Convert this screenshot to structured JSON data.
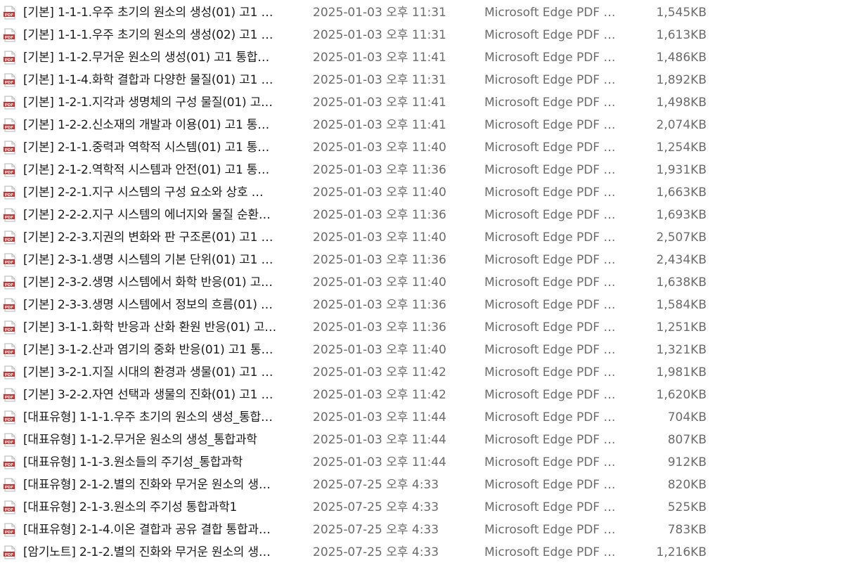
{
  "icon": {
    "name": "pdf-file-icon",
    "label": "PDF",
    "color": "#d0312d"
  },
  "files": [
    {
      "name": "[기본] 1-1-1.우주 초기의 원소의 생성(01) 고1 …",
      "modified": "2025-01-03 오후 11:31",
      "type": "Microsoft Edge PDF …",
      "size": "1,545KB"
    },
    {
      "name": "[기본] 1-1-1.우주 초기의 원소의 생성(02) 고1 …",
      "modified": "2025-01-03 오후 11:31",
      "type": "Microsoft Edge PDF …",
      "size": "1,613KB"
    },
    {
      "name": "[기본] 1-1-2.무거운 원소의 생성(01) 고1 통합…",
      "modified": "2025-01-03 오후 11:41",
      "type": "Microsoft Edge PDF …",
      "size": "1,486KB"
    },
    {
      "name": "[기본] 1-1-4.화학 결합과 다양한 물질(01) 고1 …",
      "modified": "2025-01-03 오후 11:31",
      "type": "Microsoft Edge PDF …",
      "size": "1,892KB"
    },
    {
      "name": "[기본] 1-2-1.지각과 생명체의 구성 물질(01) 고…",
      "modified": "2025-01-03 오후 11:41",
      "type": "Microsoft Edge PDF …",
      "size": "1,498KB"
    },
    {
      "name": "[기본] 1-2-2.신소재의 개발과 이용(01) 고1 통…",
      "modified": "2025-01-03 오후 11:41",
      "type": "Microsoft Edge PDF …",
      "size": "2,074KB"
    },
    {
      "name": "[기본] 2-1-1.중력과 역학적 시스템(01) 고1 통…",
      "modified": "2025-01-03 오후 11:40",
      "type": "Microsoft Edge PDF …",
      "size": "1,254KB"
    },
    {
      "name": "[기본] 2-1-2.역학적 시스템과 안전(01) 고1 통…",
      "modified": "2025-01-03 오후 11:36",
      "type": "Microsoft Edge PDF …",
      "size": "1,931KB"
    },
    {
      "name": "[기본] 2-2-1.지구 시스템의 구성 요소와 상호 …",
      "modified": "2025-01-03 오후 11:40",
      "type": "Microsoft Edge PDF …",
      "size": "1,663KB"
    },
    {
      "name": "[기본] 2-2-2.지구 시스템의 에너지와 물질 순환…",
      "modified": "2025-01-03 오후 11:36",
      "type": "Microsoft Edge PDF …",
      "size": "1,693KB"
    },
    {
      "name": "[기본] 2-2-3.지권의 변화와 판 구조론(01) 고1 …",
      "modified": "2025-01-03 오후 11:40",
      "type": "Microsoft Edge PDF …",
      "size": "2,507KB"
    },
    {
      "name": "[기본] 2-3-1.생명 시스템의 기본 단위(01) 고1 …",
      "modified": "2025-01-03 오후 11:36",
      "type": "Microsoft Edge PDF …",
      "size": "2,434KB"
    },
    {
      "name": "[기본] 2-3-2.생명 시스템에서 화학 반응(01) 고…",
      "modified": "2025-01-03 오후 11:40",
      "type": "Microsoft Edge PDF …",
      "size": "1,638KB"
    },
    {
      "name": "[기본] 2-3-3.생명 시스템에서 정보의 흐름(01) …",
      "modified": "2025-01-03 오후 11:36",
      "type": "Microsoft Edge PDF …",
      "size": "1,584KB"
    },
    {
      "name": "[기본] 3-1-1.화학 반응과 산화 환원 반응(01) 고…",
      "modified": "2025-01-03 오후 11:36",
      "type": "Microsoft Edge PDF …",
      "size": "1,251KB"
    },
    {
      "name": "[기본] 3-1-2.산과 염기의 중화 반응(01) 고1 통…",
      "modified": "2025-01-03 오후 11:40",
      "type": "Microsoft Edge PDF …",
      "size": "1,321KB"
    },
    {
      "name": "[기본] 3-2-1.지질 시대의 환경과 생물(01) 고1 …",
      "modified": "2025-01-03 오후 11:42",
      "type": "Microsoft Edge PDF …",
      "size": "1,981KB"
    },
    {
      "name": "[기본] 3-2-2.자연 선택과 생물의 진화(01) 고1 …",
      "modified": "2025-01-03 오후 11:42",
      "type": "Microsoft Edge PDF …",
      "size": "1,620KB"
    },
    {
      "name": "[대표유형] 1-1-1.우주 초기의 원소의 생성_통합…",
      "modified": "2025-01-03 오후 11:44",
      "type": "Microsoft Edge PDF …",
      "size": "704KB"
    },
    {
      "name": "[대표유형] 1-1-2.무거운 원소의 생성_통합과학",
      "modified": "2025-01-03 오후 11:44",
      "type": "Microsoft Edge PDF …",
      "size": "807KB"
    },
    {
      "name": "[대표유형] 1-1-3.원소들의 주기성_통합과학",
      "modified": "2025-01-03 오후 11:44",
      "type": "Microsoft Edge PDF …",
      "size": "912KB"
    },
    {
      "name": "[대표유형] 2-1-2.별의 진화와 무거운 원소의 생…",
      "modified": "2025-07-25 오후 4:33",
      "type": "Microsoft Edge PDF …",
      "size": "820KB"
    },
    {
      "name": "[대표유형] 2-1-3.원소의 주기성 통합과학1",
      "modified": "2025-07-25 오후 4:33",
      "type": "Microsoft Edge PDF …",
      "size": "525KB"
    },
    {
      "name": "[대표유형] 2-1-4.이온 결합과 공유 결합 통합과…",
      "modified": "2025-07-25 오후 4:33",
      "type": "Microsoft Edge PDF …",
      "size": "783KB"
    },
    {
      "name": "[암기노트] 2-1-2.별의 진화와 무거운 원소의 생…",
      "modified": "2025-07-25 오후 4:33",
      "type": "Microsoft Edge PDF …",
      "size": "1,216KB"
    }
  ]
}
